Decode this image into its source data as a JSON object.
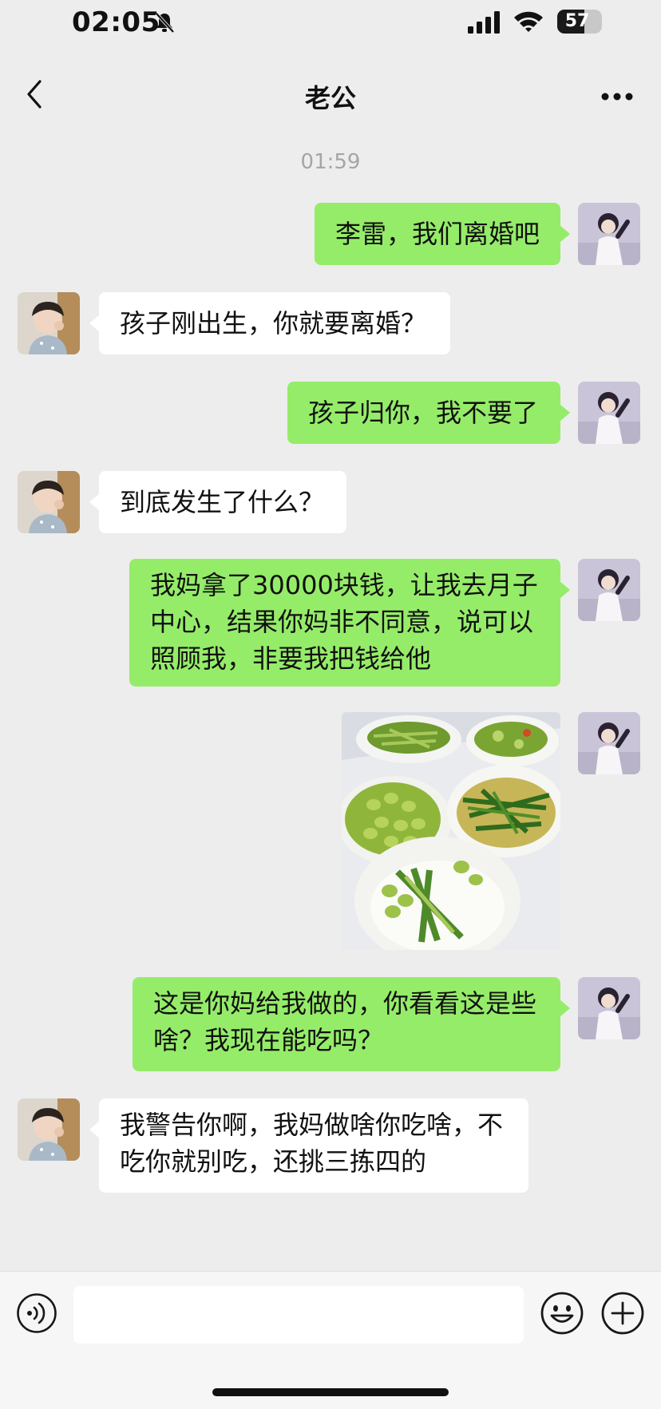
{
  "status_bar": {
    "time": "02:05",
    "battery": "57",
    "battery_level": 0.57
  },
  "header": {
    "title": "老公"
  },
  "timestamp": "01:59",
  "messages": [
    {
      "side": "out",
      "text": "李雷，我们离婚吧"
    },
    {
      "side": "in",
      "text": "孩子刚出生，你就要离婚？"
    },
    {
      "side": "out",
      "text": "孩子归你，我不要了"
    },
    {
      "side": "in",
      "text": "到底发生了什么？"
    },
    {
      "side": "out",
      "text": "我妈拿了30000块钱，让我去月子\n中心，结果你妈非不同意，说可以\n照顾我，非要我把钱给他"
    },
    {
      "side": "out",
      "type": "image",
      "image": "photo-of-green-vegetable-dishes-and-rice"
    },
    {
      "side": "out",
      "text": "这是你妈给我做的，你看看这是些\n啥？我现在能吃吗？"
    },
    {
      "side": "in",
      "text": "我警告你啊，我妈做啥你吃啥，不\n吃你就别吃，还挑三拣四的"
    }
  ],
  "input": {
    "value": ""
  },
  "icons": {
    "back": "chevron-left-icon",
    "more": "more-dots-icon",
    "voice": "voice-icon",
    "emoji": "emoji-icon",
    "plus": "plus-icon"
  },
  "colors": {
    "background": "#ededed",
    "outgoing_bubble": "#95ec69",
    "incoming_bubble": "#ffffff"
  }
}
